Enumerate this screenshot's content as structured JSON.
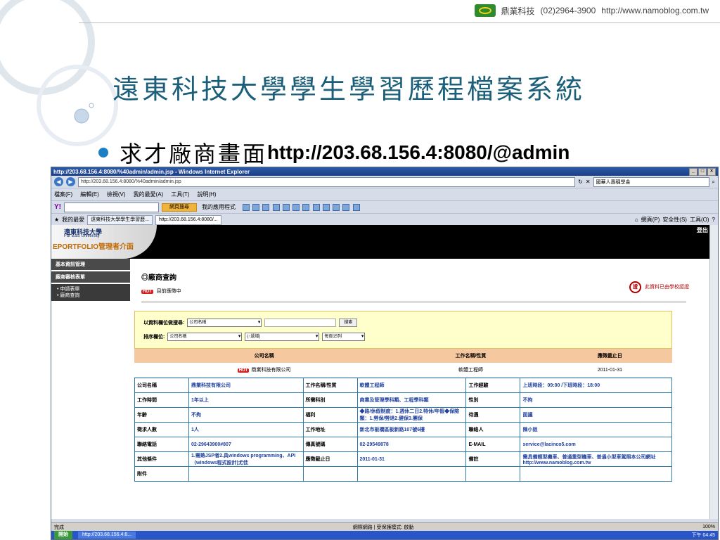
{
  "slide": {
    "company": "鼎業科技",
    "phone": "(02)2964-3900",
    "website": "http://www.namoblog.com.tw",
    "title": "遠東科技大學學生學習歷程檔案系統",
    "bullet_cjk": "求才廠商畫面",
    "bullet_url": "http://203.68.156.4:8080/@admin"
  },
  "browser": {
    "window_title": "http://203.68.156.4:8080/%40admin/admin.jsp - Windows Internet Explorer",
    "address": "http://203.68.156.4:8080/%40admin/admin.jsp",
    "search_text": "國華人壽稱學金",
    "menu": [
      "檔案(F)",
      "編輯(E)",
      "檢視(V)",
      "我的最愛(A)",
      "工具(T)",
      "說明(H)"
    ],
    "toolbar_search_btn": "網頁搜尋",
    "apps_label": "我的應用程式",
    "favorites_label": "我的最愛",
    "tab1": "遠東科技大學學生學習歷...",
    "tab2": "http://203.68.156.4:8080/...",
    "cmd_page": "網頁(P)",
    "cmd_security": "安全性(S)",
    "cmd_tools": "工具(O)",
    "status_done": "完成",
    "status_zone": "網際網路 | 受保護模式: 啟動",
    "zoom": "100%"
  },
  "app": {
    "logo_name": "遠東科技大學",
    "logo_en": "Far East University",
    "logo_portal": "EPORTFOLIO管理者介面",
    "logout": "登出",
    "sidebar_head1": "基本資訊管理",
    "sidebar_head2": "廠商審核表單",
    "sidebar_links": [
      "• 申請表單",
      "• 廠商查詢"
    ],
    "page_title": "◎廠商查詢",
    "hot": "HOT",
    "status": "目前應徵中",
    "cert_text": "此資料已由學校認證",
    "search_field_label": "以資料欄位做搜尋:",
    "search_field_value": "公司名稱",
    "search_btn": "搜索",
    "sort_label": "排序欄位:",
    "sort_field": "公司名稱",
    "sort_order": "(↑遞增)",
    "per_page": "每頁15列"
  },
  "summary": {
    "headers": [
      "公司名稱",
      "工作名稱/性質",
      "應徵截止日"
    ],
    "row": [
      "鼎業科技有限公司",
      "軟體工程師",
      "2011-01-31"
    ]
  },
  "details": [
    [
      "公司名稱",
      "鼎業科技有限公司",
      "工作名稱/性質",
      "軟體工程師",
      "工作經驗",
      "上班時段：09:00 /下班時段：18:00"
    ],
    [
      "工作時間",
      "1年以上",
      "所需科別",
      "商業及管理學科類、工程學科類",
      "性別",
      "不拘"
    ],
    [
      "年齡",
      "不拘",
      "福利",
      "◆路/休假制度：1.週休二日2.特休/年假◆保險類：1.勞保/勞退2.健保3.團保",
      "待遇",
      "面議"
    ],
    [
      "徵求人數",
      "1人",
      "工作地址",
      "新北市板橋區板新路107號6樓",
      "聯絡人",
      "陳小姐"
    ],
    [
      "聯絡電話",
      "02-29643900#807",
      "傳真號碼",
      "02-29549878",
      "E-MAIL",
      "service@lacinco5.com"
    ],
    [
      "其他條件",
      "1.需熟JSP者2.具windows programming、API（windows程式設計)尤佳",
      "應徵截止日",
      "2011-01-31",
      "備註",
      "需具備輕型機車、普通重型機車、普通小型車駕照本公司網址 http://www.namoblog.com.tw"
    ],
    [
      "附件",
      "",
      "",
      "",
      "",
      ""
    ]
  ],
  "taskbar": {
    "start": "開始",
    "task": "http://203.68.156.4:8...",
    "clock": "下午 04:45"
  }
}
